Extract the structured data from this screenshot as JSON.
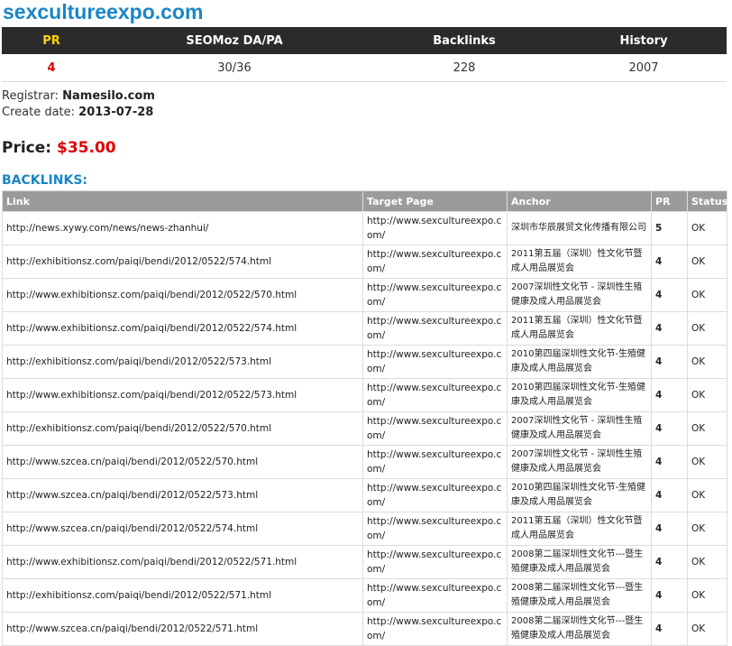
{
  "domain": "sexcultureexpo.com",
  "stats": {
    "headers": {
      "pr": "PR",
      "seomoz": "SEOMoz DA/PA",
      "backlinks": "Backlinks",
      "history": "History"
    },
    "values": {
      "pr": "4",
      "seomoz": "30/36",
      "backlinks": "228",
      "history": "2007"
    }
  },
  "registrar": {
    "label": "Registrar:",
    "value": "Namesilo.com"
  },
  "create_date": {
    "label": "Create date:",
    "value": "2013-07-28"
  },
  "price": {
    "label": "Price:",
    "value": "$35.00"
  },
  "backlinks_heading": "BACKLINKS:",
  "backlinks_table": {
    "headers": {
      "link": "Link",
      "target": "Target Page",
      "anchor": "Anchor",
      "pr": "PR",
      "status": "Status"
    },
    "rows": [
      {
        "link": "http://news.xywy.com/news/news-zhanhui/",
        "target": "http://www.sexcultureexpo.com/",
        "anchor": "深圳市华辰展贸文化传播有限公司",
        "pr": "5",
        "status": "OK"
      },
      {
        "link": "http://exhibitionsz.com/paiqi/bendi/2012/0522/574.html",
        "target": "http://www.sexcultureexpo.com/",
        "anchor": "2011第五届（深圳）性文化节暨成人用品展览会",
        "pr": "4",
        "status": "OK"
      },
      {
        "link": "http://www.exhibitionsz.com/paiqi/bendi/2012/0522/570.html",
        "target": "http://www.sexcultureexpo.com/",
        "anchor": "2007深圳性文化节 - 深圳性生殖健康及成人用品展览会",
        "pr": "4",
        "status": "OK"
      },
      {
        "link": "http://www.exhibitionsz.com/paiqi/bendi/2012/0522/574.html",
        "target": "http://www.sexcultureexpo.com/",
        "anchor": "2011第五届（深圳）性文化节暨成人用品展览会",
        "pr": "4",
        "status": "OK"
      },
      {
        "link": "http://exhibitionsz.com/paiqi/bendi/2012/0522/573.html",
        "target": "http://www.sexcultureexpo.com/",
        "anchor": "2010第四届深圳性文化节-生殖健康及成人用品展览会",
        "pr": "4",
        "status": "OK"
      },
      {
        "link": "http://www.exhibitionsz.com/paiqi/bendi/2012/0522/573.html",
        "target": "http://www.sexcultureexpo.com/",
        "anchor": "2010第四届深圳性文化节-生殖健康及成人用品展览会",
        "pr": "4",
        "status": "OK"
      },
      {
        "link": "http://exhibitionsz.com/paiqi/bendi/2012/0522/570.html",
        "target": "http://www.sexcultureexpo.com/",
        "anchor": "2007深圳性文化节 - 深圳性生殖健康及成人用品展览会",
        "pr": "4",
        "status": "OK"
      },
      {
        "link": "http://www.szcea.cn/paiqi/bendi/2012/0522/570.html",
        "target": "http://www.sexcultureexpo.com/",
        "anchor": "2007深圳性文化节 - 深圳性生殖健康及成人用品展览会",
        "pr": "4",
        "status": "OK"
      },
      {
        "link": "http://www.szcea.cn/paiqi/bendi/2012/0522/573.html",
        "target": "http://www.sexcultureexpo.com/",
        "anchor": "2010第四届深圳性文化节-生殖健康及成人用品展览会",
        "pr": "4",
        "status": "OK"
      },
      {
        "link": "http://www.szcea.cn/paiqi/bendi/2012/0522/574.html",
        "target": "http://www.sexcultureexpo.com/",
        "anchor": "2011第五届（深圳）性文化节暨成人用品展览会",
        "pr": "4",
        "status": "OK"
      },
      {
        "link": "http://www.exhibitionsz.com/paiqi/bendi/2012/0522/571.html",
        "target": "http://www.sexcultureexpo.com/",
        "anchor": "2008第二届深圳性文化节---暨生殖健康及成人用品展览会",
        "pr": "4",
        "status": "OK"
      },
      {
        "link": "http://exhibitionsz.com/paiqi/bendi/2012/0522/571.html",
        "target": "http://www.sexcultureexpo.com/",
        "anchor": "2008第二届深圳性文化节---暨生殖健康及成人用品展览会",
        "pr": "4",
        "status": "OK"
      },
      {
        "link": "http://www.szcea.cn/paiqi/bendi/2012/0522/571.html",
        "target": "http://www.sexcultureexpo.com/",
        "anchor": "2008第二届深圳性文化节---暨生殖健康及成人用品展览会",
        "pr": "4",
        "status": "OK"
      }
    ]
  }
}
